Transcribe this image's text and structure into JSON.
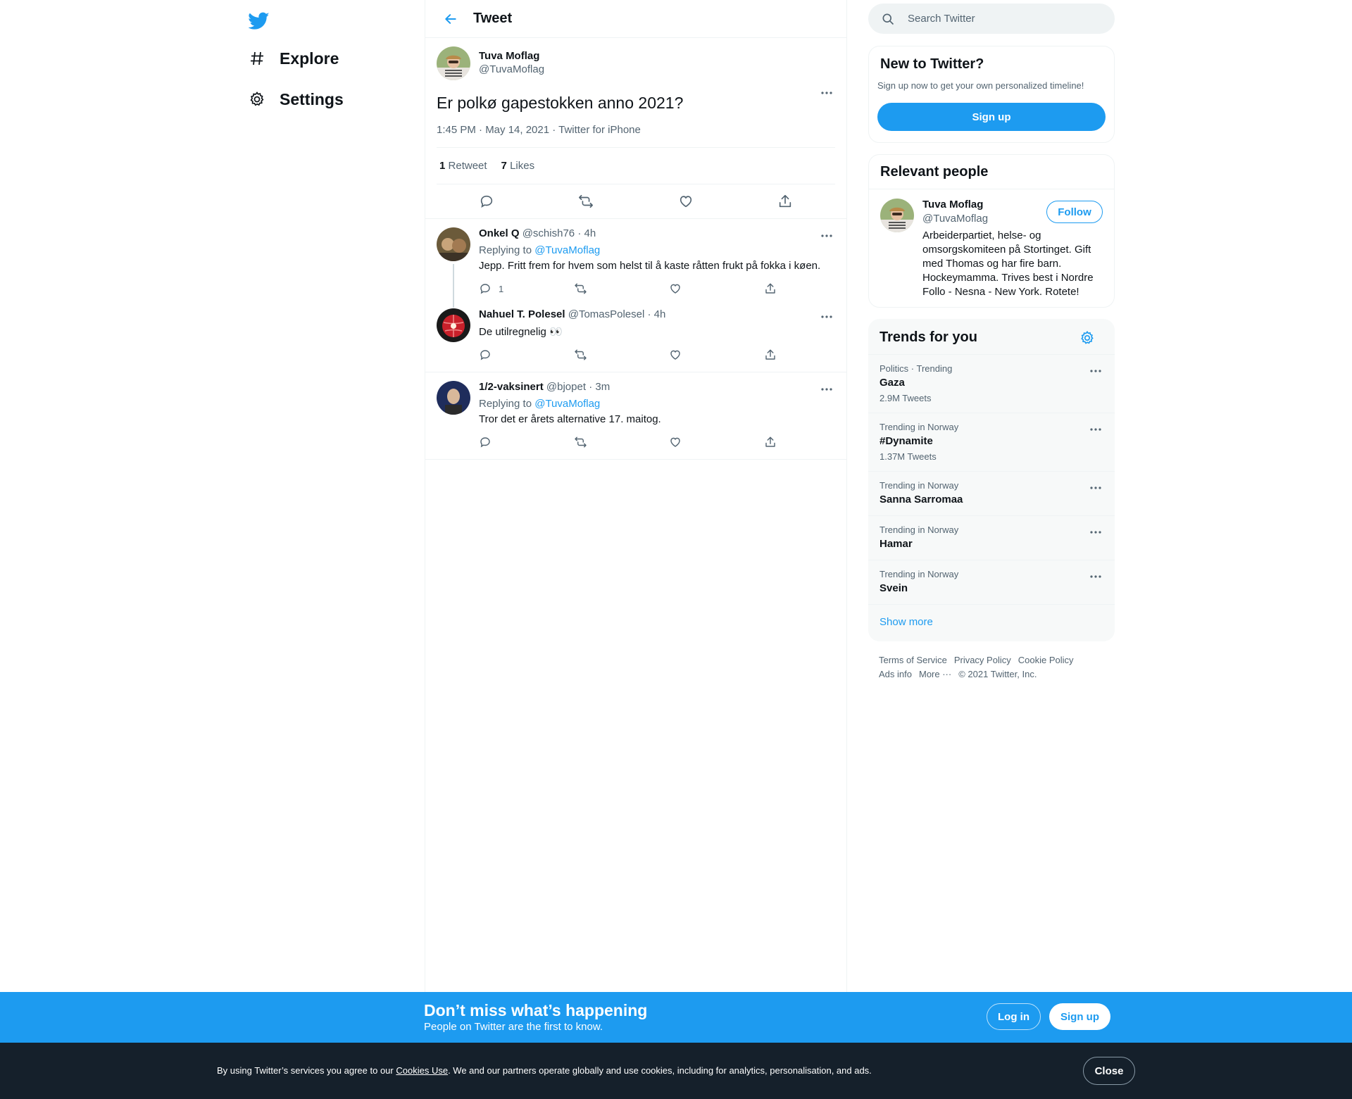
{
  "colors": {
    "accent": "#1d9bf0",
    "text": "#0f1419",
    "muted": "#536471",
    "dark_bar": "#15202b"
  },
  "nav": {
    "logo": "twitter-bird-icon",
    "items": [
      {
        "label": "Explore",
        "icon": "hashtag-icon"
      },
      {
        "label": "Settings",
        "icon": "gear-icon"
      }
    ]
  },
  "header": {
    "title": "Tweet"
  },
  "tweet": {
    "name": "Tuva Moflag",
    "handle": "@TuvaMoflag",
    "text": "Er polkø gapestokken anno 2021?",
    "meta": "1:45 PM · May 14, 2021 · Twitter for iPhone",
    "retweets_count": "1",
    "retweets_label": "Retweet",
    "likes_count": "7",
    "likes_label": "Likes"
  },
  "replies": [
    {
      "name": "Onkel Q",
      "handle": "@schish76",
      "time": "· 4h",
      "replying_prefix": "Replying to",
      "replying_to": "@TuvaMoflag",
      "text": "Jepp. Fritt frem for hvem som helst til å kaste råtten frukt på fokka i køen.",
      "reply_count": "1"
    },
    {
      "name": "Nahuel T. Polesel",
      "handle": "@TomasPolesel",
      "time": "· 4h",
      "text": "De utilregnelig 👀"
    },
    {
      "name": "1/2-vaksinert",
      "handle": "@bjopet",
      "time": "· 3m",
      "replying_prefix": "Replying to",
      "replying_to": "@TuvaMoflag",
      "text": "Tror det er årets alternative 17. maitog."
    }
  ],
  "search": {
    "placeholder": "Search Twitter"
  },
  "new_to_twitter": {
    "title": "New to Twitter?",
    "subtitle": "Sign up now to get your own personalized timeline!",
    "button": "Sign up"
  },
  "relevant_people": {
    "title": "Relevant people",
    "name": "Tuva Moflag",
    "handle": "@TuvaMoflag",
    "follow": "Follow",
    "bio": "Arbeiderpartiet, helse- og omsorgskomiteen på Stortinget. Gift med Thomas og har fire barn. Hockeymamma. Trives best i Nordre Follo - Nesna - New York. Rotete!"
  },
  "trends": {
    "title": "Trends for you",
    "items": [
      {
        "category": "Politics · Trending",
        "name": "Gaza",
        "count": "2.9M Tweets"
      },
      {
        "category": "Trending in Norway",
        "name": "#Dynamite",
        "count": "1.37M Tweets"
      },
      {
        "category": "Trending in Norway",
        "name": "Sanna Sarromaa"
      },
      {
        "category": "Trending in Norway",
        "name": "Hamar"
      },
      {
        "category": "Trending in Norway",
        "name": "Svein"
      }
    ],
    "show_more": "Show more"
  },
  "footer": {
    "links": [
      "Terms of Service",
      "Privacy Policy",
      "Cookie Policy",
      "Ads info",
      "More ···"
    ],
    "copyright": "© 2021 Twitter, Inc."
  },
  "signup_bar": {
    "title": "Don’t miss what’s happening",
    "subtitle": "People on Twitter are the first to know.",
    "login": "Log in",
    "signup": "Sign up"
  },
  "cookie_bar": {
    "text_before": "By using Twitter’s services you agree to our ",
    "link": "Cookies Use",
    "text_after": ". We and our partners operate globally and use cookies, including for analytics, personalisation, and ads.",
    "close": "Close"
  }
}
